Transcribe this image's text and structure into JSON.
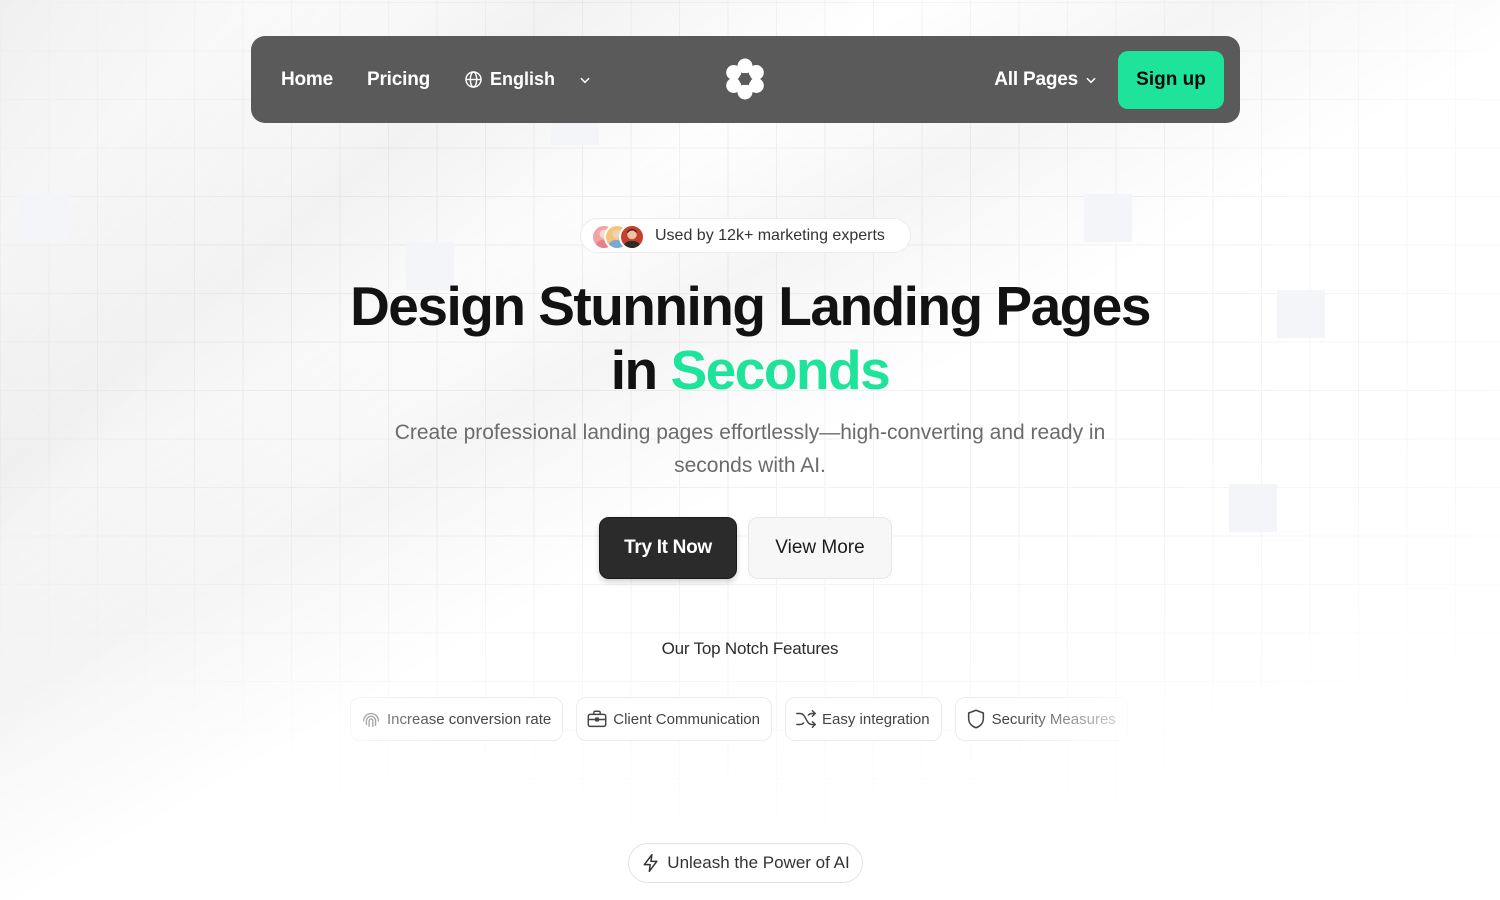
{
  "nav": {
    "home": "Home",
    "pricing": "Pricing",
    "language": "English",
    "all_pages": "All Pages",
    "signup": "Sign up"
  },
  "hero": {
    "badge_text": "Used by 12k+ marketing experts",
    "headline_line1": "Design Stunning Landing Pages",
    "headline_prefix": "in ",
    "headline_accent": "Seconds",
    "subtitle": "Create professional landing pages effortlessly—high-converting and ready in seconds with AI.",
    "primary_cta": "Try It Now",
    "secondary_cta": "View More"
  },
  "features": {
    "title": "Our Top Notch Features",
    "items": [
      {
        "label": "Increase conversion rate",
        "icon": "fingerprint-icon"
      },
      {
        "label": "Client Communication",
        "icon": "briefcase-icon"
      },
      {
        "label": "Easy integration",
        "icon": "shuffle-icon"
      },
      {
        "label": "Security Measures",
        "icon": "shield-icon"
      }
    ]
  },
  "section_pill": {
    "label": "Unleash the Power of AI",
    "icon": "lightning-icon"
  },
  "colors": {
    "accent": "#1ee39b",
    "nav_bg": "#5a5a5a",
    "primary_button": "#2b2b2b"
  }
}
